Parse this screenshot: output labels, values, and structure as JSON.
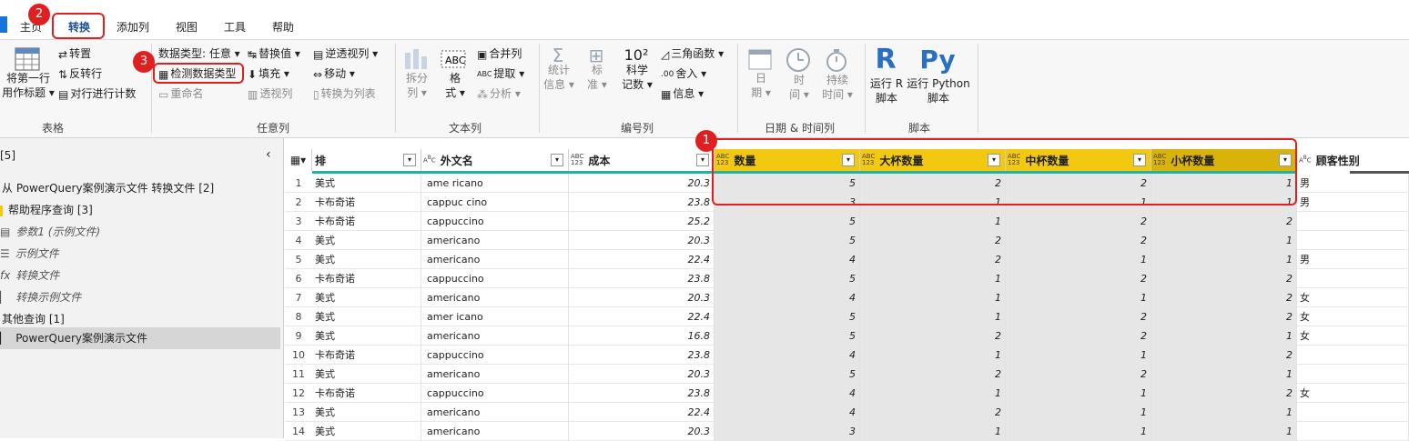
{
  "tabs": [
    "主页",
    "转换",
    "添加列",
    "视图",
    "工具",
    "帮助"
  ],
  "ribbon": {
    "table_group": {
      "label": "表格",
      "first_row_header": [
        "将第一行",
        "用作标题"
      ],
      "transpose": "转置",
      "reverse_rows": "反转行",
      "count_rows": "对行进行计数"
    },
    "any_column_group": {
      "label": "任意列",
      "data_type": "数据类型: 任意",
      "detect_type": "检测数据类型",
      "rename": "重命名",
      "replace_values": "替换值",
      "fill": "填充",
      "pivot": "透视列",
      "unpivot": "逆透视列",
      "move": "移动",
      "to_list": "转换为列表"
    },
    "text_column_group": {
      "label": "文本列",
      "split": [
        "拆分",
        "列"
      ],
      "format": [
        "格",
        "式"
      ],
      "merge": "合并列",
      "extract": "提取",
      "parse": "分析"
    },
    "number_column_group": {
      "label": "编号列",
      "stats": [
        "统计",
        "信息"
      ],
      "standard": [
        "标",
        "准"
      ],
      "scientific": [
        "科学",
        "记数"
      ],
      "scientific_icon": "10²",
      "trig": "三角函数",
      "round": "舍入",
      "info": "信息"
    },
    "datetime_group": {
      "label": "日期 & 时间列",
      "date": [
        "日",
        "期"
      ],
      "time": [
        "时",
        "间"
      ],
      "duration": [
        "持续",
        "时间"
      ]
    },
    "script_group": {
      "label": "脚本",
      "run_r": [
        "运行 R",
        "脚本"
      ],
      "run_py": [
        "运行 Python",
        "脚本"
      ],
      "r_icon": "R",
      "py_icon": "Py"
    }
  },
  "left_pane": {
    "header": "[5]",
    "items": [
      "从 PowerQuery案例演示文件 转换文件 [2]",
      "帮助程序查询 [3]",
      "参数1 (示例文件)",
      "示例文件",
      "转换文件",
      "转换示例文件",
      "其他查询 [1]",
      "PowerQuery案例演示文件"
    ]
  },
  "grid": {
    "columns": [
      {
        "name": "排",
        "type": ""
      },
      {
        "name": "外文名",
        "type": "ABC"
      },
      {
        "name": "成本",
        "type": "ABC123"
      },
      {
        "name": "数量",
        "type": "ABC123"
      },
      {
        "name": "大杯数量",
        "type": "ABC123"
      },
      {
        "name": "中杯数量",
        "type": "ABC123"
      },
      {
        "name": "小杯数量",
        "type": "ABC123"
      },
      {
        "name": "顾客性别",
        "type": "ABC"
      }
    ],
    "rows": [
      [
        "1",
        "美式",
        "ame ricano",
        "20.3",
        "5",
        "2",
        "2",
        "1",
        "男"
      ],
      [
        "2",
        "卡布奇诺",
        "cappuc cino",
        "23.8",
        "3",
        "1",
        "1",
        "1",
        "男"
      ],
      [
        "3",
        "卡布奇诺",
        "cappuccino",
        "25.2",
        "5",
        "1",
        "2",
        "2",
        ""
      ],
      [
        "4",
        "美式",
        "americano",
        "20.3",
        "5",
        "2",
        "2",
        "1",
        ""
      ],
      [
        "5",
        "美式",
        "americano",
        "22.4",
        "4",
        "2",
        "1",
        "1",
        "男"
      ],
      [
        "6",
        "卡布奇诺",
        "cappuccino",
        "23.8",
        "5",
        "1",
        "2",
        "2",
        ""
      ],
      [
        "7",
        "美式",
        "americano",
        "20.3",
        "4",
        "1",
        "1",
        "2",
        "女"
      ],
      [
        "8",
        "美式",
        "amer icano",
        "22.4",
        "5",
        "1",
        "2",
        "2",
        "女"
      ],
      [
        "9",
        "美式",
        "americano",
        "16.8",
        "5",
        "2",
        "2",
        "1",
        "女"
      ],
      [
        "10",
        "卡布奇诺",
        "cappuccino",
        "23.8",
        "4",
        "1",
        "1",
        "2",
        ""
      ],
      [
        "11",
        "美式",
        "americano",
        "20.3",
        "5",
        "2",
        "2",
        "1",
        ""
      ],
      [
        "12",
        "卡布奇诺",
        "cappuccino",
        "23.8",
        "4",
        "1",
        "1",
        "2",
        "女"
      ],
      [
        "13",
        "美式",
        "americano",
        "22.4",
        "4",
        "2",
        "1",
        "1",
        ""
      ],
      [
        "14",
        "美式",
        "americano",
        "20.3",
        "3",
        "1",
        "1",
        "1",
        ""
      ]
    ]
  },
  "annotations": {
    "badge1": "1",
    "badge2": "2",
    "badge3": "3"
  },
  "colors": {
    "accent": "#f2c811",
    "annotation": "#e02020",
    "brand": "#1a73d8"
  }
}
